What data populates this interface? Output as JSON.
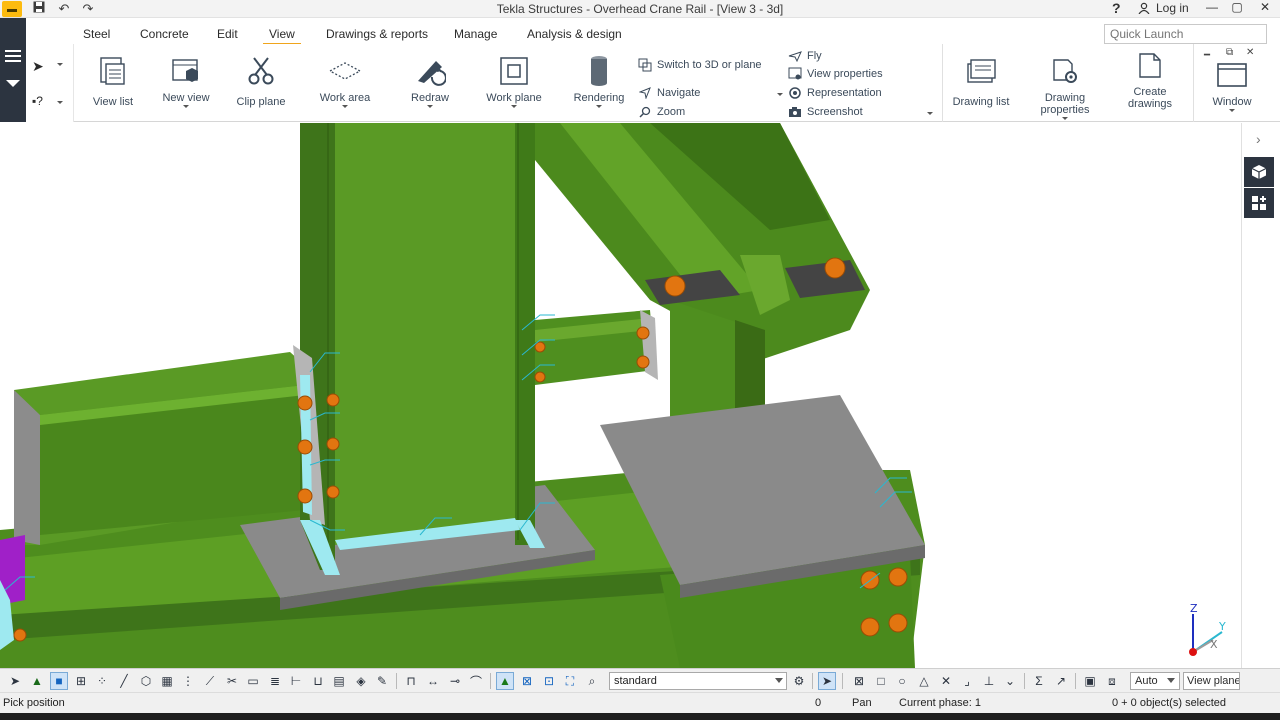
{
  "window": {
    "title": "Tekla Structures - Overhead Crane Rail  - [View 3 - 3d]",
    "help_label": "?",
    "login_label": "Log in"
  },
  "tabs": [
    "Steel",
    "Concrete",
    "Edit",
    "View",
    "Drawings & reports",
    "Manage",
    "Analysis & design"
  ],
  "active_tab": "View",
  "quick_launch": {
    "placeholder": "Quick Launch"
  },
  "ribbon": {
    "view_list": "View list",
    "new_view": "New view",
    "clip_plane": "Clip plane",
    "work_area": "Work area",
    "redraw": "Redraw",
    "work_plane": "Work plane",
    "rendering": "Rendering",
    "switch_3d": "Switch to 3D or plane",
    "navigate": "Navigate",
    "zoom": "Zoom",
    "fly": "Fly",
    "view_properties": "View properties",
    "representation": "Representation",
    "screenshot": "Screenshot",
    "drawing_list": "Drawing list",
    "drawing_properties_1": "Drawing",
    "drawing_properties_2": "properties",
    "create_drawings_1": "Create",
    "create_drawings_2": "drawings",
    "window": "Window"
  },
  "toolbar": {
    "view_filter": "standard",
    "auto_select": "Auto",
    "view_plane": "View plane"
  },
  "axes": {
    "z": "Z",
    "y": "Y",
    "x": "X"
  },
  "status": {
    "prompt": "Pick position",
    "number": "0",
    "mode": "Pan",
    "phase": "Current phase: 1",
    "selected": "0 + 0 object(s) selected"
  },
  "colors": {
    "steel_green": "#4f8f1f",
    "steel_green_dark": "#3a6d16",
    "steel_green_light": "#6aa82e",
    "plate_grey": "#8a8a8a",
    "bolt_orange": "#e57a10",
    "weld_cyan": "#6fe3ec",
    "accent_tab": "#f0a51c",
    "panel_dark": "#2c3440"
  }
}
